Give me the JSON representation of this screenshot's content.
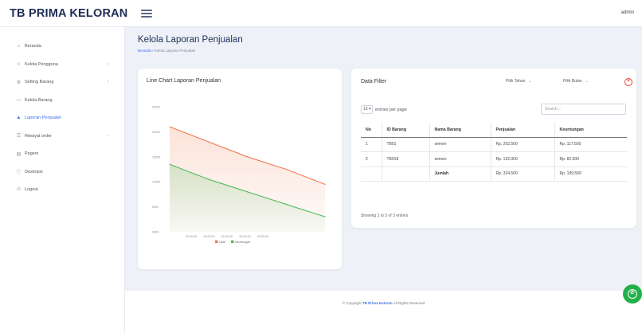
{
  "app": {
    "brand": "TB PRIMA KELORAN",
    "user": "admin"
  },
  "sidebar": {
    "items": [
      {
        "label": "Beranda",
        "icon": "home-icon",
        "glyph": "⌂",
        "has_chevron": false,
        "active": false
      },
      {
        "label": "Kelola Pengguna",
        "icon": "users-icon",
        "glyph": "☺",
        "has_chevron": true,
        "active": false
      },
      {
        "label": "Setting Barang",
        "icon": "gear-icon",
        "glyph": "⚙",
        "has_chevron": true,
        "active": false
      },
      {
        "label": "Kelola Barang",
        "icon": "box-icon",
        "glyph": "▭",
        "has_chevron": false,
        "active": false
      },
      {
        "label": "Laporan Penjualan",
        "icon": "chart-icon",
        "glyph": "▲",
        "has_chevron": false,
        "active": true
      },
      {
        "label": "Riwayat order",
        "icon": "history-icon",
        "glyph": "☰",
        "has_chevron": true,
        "active": false
      },
      {
        "label": "Pagers",
        "icon": "pages-icon",
        "glyph": "▤",
        "has_chevron": false,
        "active": false
      },
      {
        "label": "Deskripsi",
        "icon": "info-icon",
        "glyph": "ⓘ",
        "has_chevron": false,
        "active": false
      },
      {
        "label": "Logout",
        "icon": "logout-icon",
        "glyph": "⏻",
        "has_chevron": false,
        "active": false
      }
    ]
  },
  "page": {
    "title": "Kelola Laporan Penjualan",
    "breadcrumb_home": "Beranda",
    "breadcrumb_sep": " / ",
    "breadcrumb_current": "Kelola Laporan Penjualan"
  },
  "chart": {
    "title": "Line Chart Laporan Penjualan"
  },
  "chart_data": {
    "type": "area",
    "categories": [
      "00.00.00",
      "00.00.00",
      "00.00.00",
      "00.00.00",
      "00.00.00"
    ],
    "y_tick_labels": [
      "25000",
      "20000",
      "15000",
      "10000",
      "5000",
      "0000"
    ],
    "series": [
      {
        "name": "Laba",
        "color": "#f07b50",
        "values": [
          21000,
          18000,
          15000,
          12500,
          9500
        ]
      },
      {
        "name": "Keuntungan",
        "color": "#4cbb5a",
        "values": [
          13500,
          10500,
          8000,
          5500,
          3000
        ]
      }
    ],
    "ylim": [
      0,
      25000
    ],
    "grid": false,
    "legend": "bottom"
  },
  "filter": {
    "title": "Data Filter",
    "year_select": "Pilih Tahun",
    "month_select": "Pilih Bulan",
    "length_value": "10",
    "length_suffix": "entries per page",
    "search_placeholder": "Search...",
    "headers": [
      "No",
      "ID Barang",
      "Nama Barang",
      "Penjualan",
      "Keuntungan"
    ],
    "rows": [
      [
        "1",
        "TB01",
        "semen",
        "Rp. 202.500",
        "Rp. 117.500"
      ],
      [
        "2",
        "TB018",
        "semen",
        "Rp. 122.000",
        "Rp. 82.000"
      ]
    ],
    "total": {
      "label": "Jumlah",
      "penjualan": "Rp. 324.500",
      "keuntungan": "Rp. 199.500"
    },
    "info": "Showing 1 to 3 of 3 entries"
  },
  "footer": {
    "prefix": "© Copyright ",
    "brand": "TB Prima Keloran",
    "suffix": " All Rights Reserved"
  }
}
